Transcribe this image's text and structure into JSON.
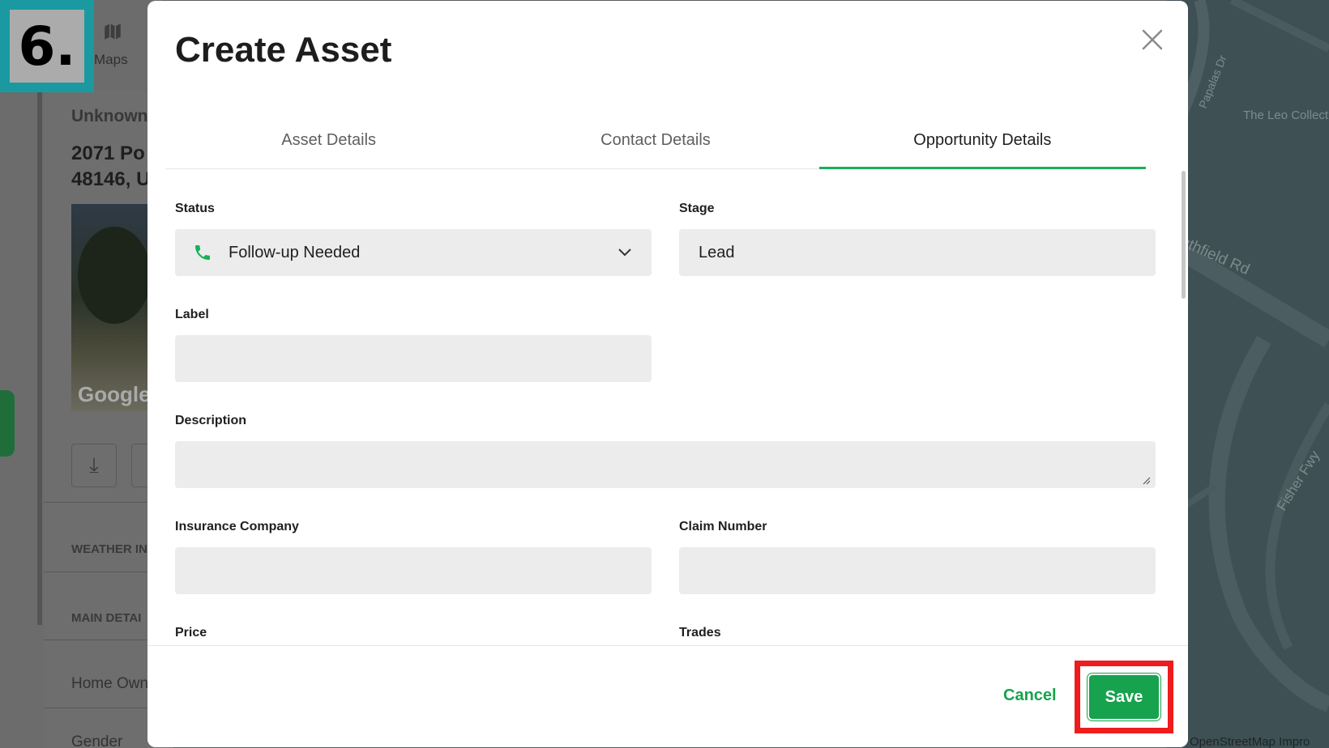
{
  "step_badge": "6.",
  "background": {
    "nav": {
      "maps_label": "Maps",
      "maps_icon": "map-icon"
    },
    "asset_header": "Unknown",
    "address_line1": "2071 Po",
    "address_line2": "48146, U",
    "street_view_logo": "Google",
    "download_icon": "download-icon",
    "section_weather": "WEATHER IN",
    "section_main": "MAIN DETAI",
    "home_owner_label": "Home Own",
    "gender_label": "Gender",
    "map": {
      "street_papalas": "Papalas Dr",
      "poi_leo": "The Leo Collect",
      "street_southfield": "uthfield Rd",
      "street_fisher": "Fisher Fwy",
      "attribution": "OpenStreetMap Impro"
    }
  },
  "modal": {
    "title": "Create Asset",
    "close_icon": "close-icon",
    "tabs": [
      {
        "label": "Asset Details",
        "active": false
      },
      {
        "label": "Contact Details",
        "active": false
      },
      {
        "label": "Opportunity Details",
        "active": true
      }
    ],
    "form": {
      "status": {
        "label": "Status",
        "value": "Follow-up Needed",
        "icon": "phone-icon",
        "status_color": "#17b05a"
      },
      "stage": {
        "label": "Stage",
        "value": "Lead"
      },
      "label_field": {
        "label": "Label",
        "value": ""
      },
      "description": {
        "label": "Description",
        "value": ""
      },
      "insurance_company": {
        "label": "Insurance Company",
        "value": ""
      },
      "claim_number": {
        "label": "Claim Number",
        "value": ""
      },
      "price": {
        "label": "Price"
      },
      "trades": {
        "label": "Trades"
      }
    },
    "footer": {
      "cancel_label": "Cancel",
      "save_label": "Save"
    }
  },
  "colors": {
    "accent_green": "#17a24e",
    "highlight_red": "#ee1c1c",
    "badge_teal": "#1a9aa0"
  }
}
